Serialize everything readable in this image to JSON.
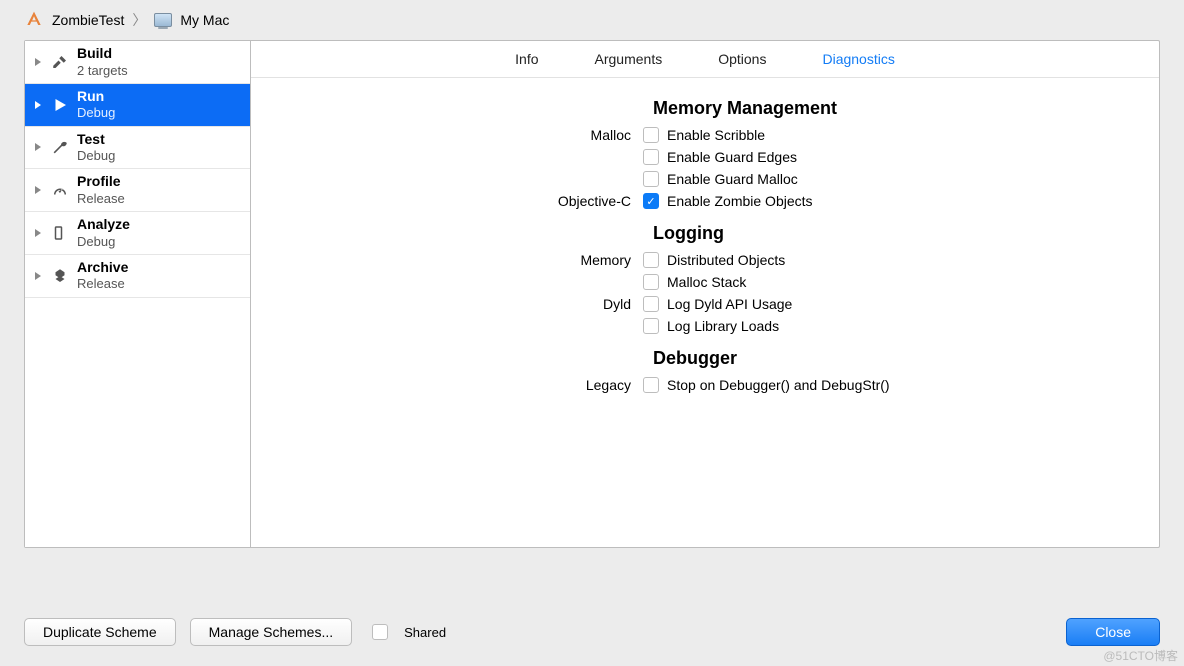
{
  "breadcrumb": {
    "project": "ZombieTest",
    "destination": "My Mac"
  },
  "sidebar": {
    "items": [
      {
        "title": "Build",
        "sub": "2 targets"
      },
      {
        "title": "Run",
        "sub": "Debug"
      },
      {
        "title": "Test",
        "sub": "Debug"
      },
      {
        "title": "Profile",
        "sub": "Release"
      },
      {
        "title": "Analyze",
        "sub": "Debug"
      },
      {
        "title": "Archive",
        "sub": "Release"
      }
    ],
    "selected_index": 1
  },
  "tabs": {
    "items": [
      "Info",
      "Arguments",
      "Options",
      "Diagnostics"
    ],
    "active_index": 3
  },
  "sections": {
    "memory": {
      "title": "Memory Management",
      "malloc_label": "Malloc",
      "objc_label": "Objective-C",
      "scribble": {
        "label": "Enable Scribble",
        "checked": false
      },
      "guard_edges": {
        "label": "Enable Guard Edges",
        "checked": false
      },
      "guard_malloc": {
        "label": "Enable Guard Malloc",
        "checked": false
      },
      "zombie": {
        "label": "Enable Zombie Objects",
        "checked": true
      }
    },
    "logging": {
      "title": "Logging",
      "memory_label": "Memory",
      "dyld_label": "Dyld",
      "distributed": {
        "label": "Distributed Objects",
        "checked": false
      },
      "malloc_stack": {
        "label": "Malloc Stack",
        "checked": false
      },
      "dyld_api": {
        "label": "Log Dyld API Usage",
        "checked": false
      },
      "lib_loads": {
        "label": "Log Library Loads",
        "checked": false
      }
    },
    "debugger": {
      "title": "Debugger",
      "legacy_label": "Legacy",
      "stop": {
        "label": "Stop on Debugger() and DebugStr()",
        "checked": false
      }
    }
  },
  "footer": {
    "duplicate": "Duplicate Scheme",
    "manage": "Manage Schemes...",
    "shared_label": "Shared",
    "shared_checked": false,
    "close": "Close"
  },
  "watermark": "@51CTO博客"
}
